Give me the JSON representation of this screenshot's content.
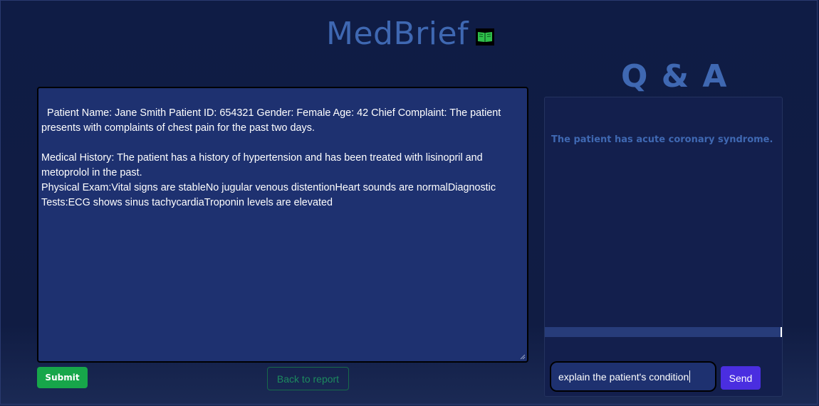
{
  "header": {
    "title": "MedBrief",
    "icon": "open-book-icon"
  },
  "report": {
    "text": "Patient Name: Jane Smith Patient ID: 654321 Gender: Female Age: 42 Chief Complaint: The patient presents with complaints of chest pain for the past two days.\n\nMedical History: The patient has a history of hypertension and has been treated with lisinopril and metoprolol in the past.\nPhysical Exam:Vital signs are stableNo jugular venous distentionHeart sounds are normalDiagnostic Tests:ECG shows sinus tachycardiaTroponin levels are elevated"
  },
  "actions": {
    "submit_label": "Submit",
    "back_label": "Back to report"
  },
  "qa": {
    "title": "Q & A",
    "answer": "The patient has acute coronary syndrome.",
    "input_value": "explain the patient's condition",
    "send_label": "Send"
  },
  "colors": {
    "background": "#101c43",
    "accent": "#3f68b2",
    "report_bg": "#1e3170",
    "submit": "#17a64a",
    "back_border": "#176a4a",
    "send": "#4a2ee0"
  }
}
